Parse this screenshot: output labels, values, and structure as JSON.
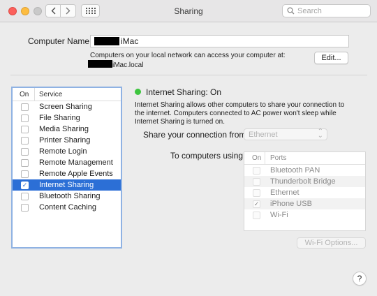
{
  "window": {
    "title": "Sharing"
  },
  "toolbar": {
    "back_icon": "chevron-left",
    "forward_icon": "chevron-right",
    "grid_icon": "show-all-grid",
    "search_placeholder": "Search"
  },
  "computer_name": {
    "label": "Computer Name:",
    "value_suffix": "iMac",
    "description": "Computers on your local network can access your computer at:",
    "address_suffix": "iMac.local",
    "edit_label": "Edit..."
  },
  "services": {
    "header_on": "On",
    "header_service": "Service",
    "items": [
      {
        "label": "Screen Sharing",
        "checked": false,
        "selected": false
      },
      {
        "label": "File Sharing",
        "checked": false,
        "selected": false
      },
      {
        "label": "Media Sharing",
        "checked": false,
        "selected": false
      },
      {
        "label": "Printer Sharing",
        "checked": false,
        "selected": false
      },
      {
        "label": "Remote Login",
        "checked": false,
        "selected": false
      },
      {
        "label": "Remote Management",
        "checked": false,
        "selected": false
      },
      {
        "label": "Remote Apple Events",
        "checked": false,
        "selected": false
      },
      {
        "label": "Internet Sharing",
        "checked": true,
        "selected": true
      },
      {
        "label": "Bluetooth Sharing",
        "checked": false,
        "selected": false
      },
      {
        "label": "Content Caching",
        "checked": false,
        "selected": false
      }
    ]
  },
  "detail": {
    "status_title": "Internet Sharing: On",
    "status_color": "#3ec53f",
    "description": "Internet Sharing allows other computers to share your connection to the internet. Computers connected to AC power won't sleep while Internet Sharing is turned on.",
    "share_from_label": "Share your connection from:",
    "share_from_value": "Ethernet",
    "to_label": "To computers using:",
    "ports_header_on": "On",
    "ports_header_ports": "Ports",
    "ports": [
      {
        "label": "Bluetooth PAN",
        "checked": false
      },
      {
        "label": "Thunderbolt Bridge",
        "checked": false
      },
      {
        "label": "Ethernet",
        "checked": false
      },
      {
        "label": "iPhone USB",
        "checked": true
      },
      {
        "label": "Wi-Fi",
        "checked": false
      }
    ],
    "wifi_options_label": "Wi-Fi Options...",
    "help_label": "?"
  },
  "colors": {
    "selection": "#2c6fd6",
    "focus_ring": "#8fb2e3"
  }
}
